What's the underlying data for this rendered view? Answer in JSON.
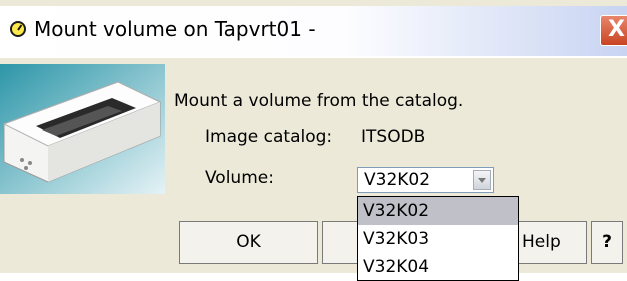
{
  "window": {
    "title": "Mount volume on Tapvrt01 -",
    "close_label": "X"
  },
  "message": "Mount a volume from the catalog.",
  "image_catalog": {
    "label": "Image catalog:",
    "value": "ITSODB"
  },
  "volume": {
    "label": "Volume:",
    "selected": "V32K02",
    "options": [
      "V32K02",
      "V32K03",
      "V32K04"
    ]
  },
  "buttons": {
    "ok": "OK",
    "cancel": "",
    "help": "Help",
    "question": "?"
  },
  "colors": {
    "close": "#c84522",
    "dialog_bg": "#ece9d8",
    "list_selected": "#c0c0c8"
  }
}
